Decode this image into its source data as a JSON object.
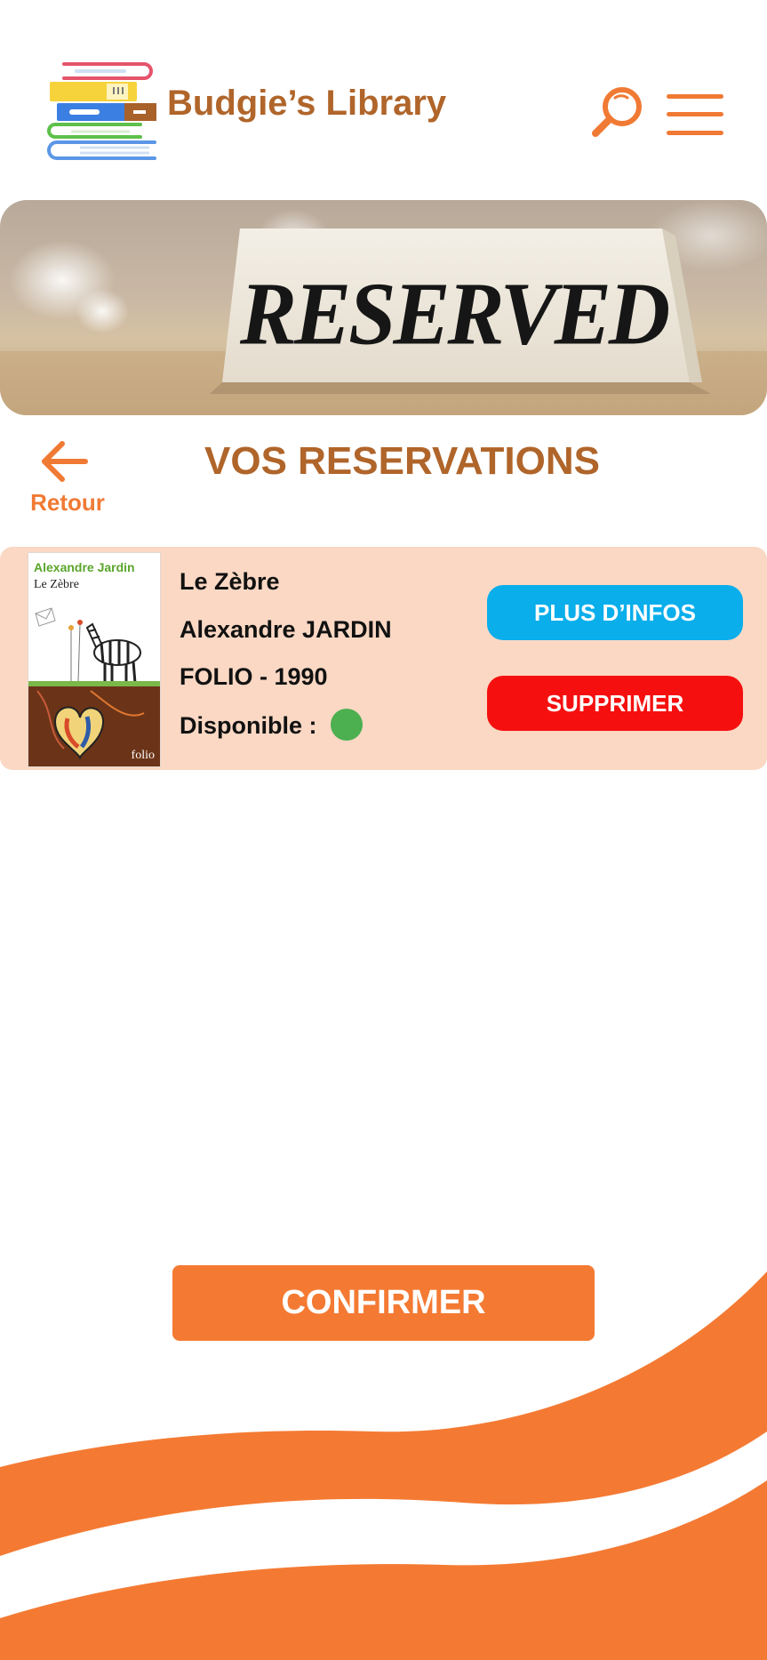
{
  "header": {
    "app_title": "Budgie’s Library",
    "logo_icon": "books-stack-icon",
    "search_icon": "search-icon",
    "menu_icon": "hamburger-menu-icon"
  },
  "banner": {
    "sign_text": "RESERVED"
  },
  "page": {
    "back_label": "Retour",
    "title": "VOS RESERVATIONS"
  },
  "reservations": [
    {
      "cover": {
        "author": "Alexandre Jardin",
        "title": "Le Zèbre",
        "publisher": "folio"
      },
      "title": "Le Zèbre",
      "author": "Alexandre JARDIN",
      "edition": "FOLIO - 1990",
      "availability_label": "Disponible :",
      "available": true,
      "more_info_label": "PLUS D’INFOS",
      "delete_label": "SUPPRIMER"
    }
  ],
  "footer": {
    "confirm_label": "CONFIRMER"
  },
  "colors": {
    "primary_orange": "#f47a33",
    "title_brown": "#b0652a",
    "card_background": "#fad8c4",
    "info_button": "#0aaeeb",
    "delete_button": "#f5100f",
    "available_green": "#4caf50"
  }
}
